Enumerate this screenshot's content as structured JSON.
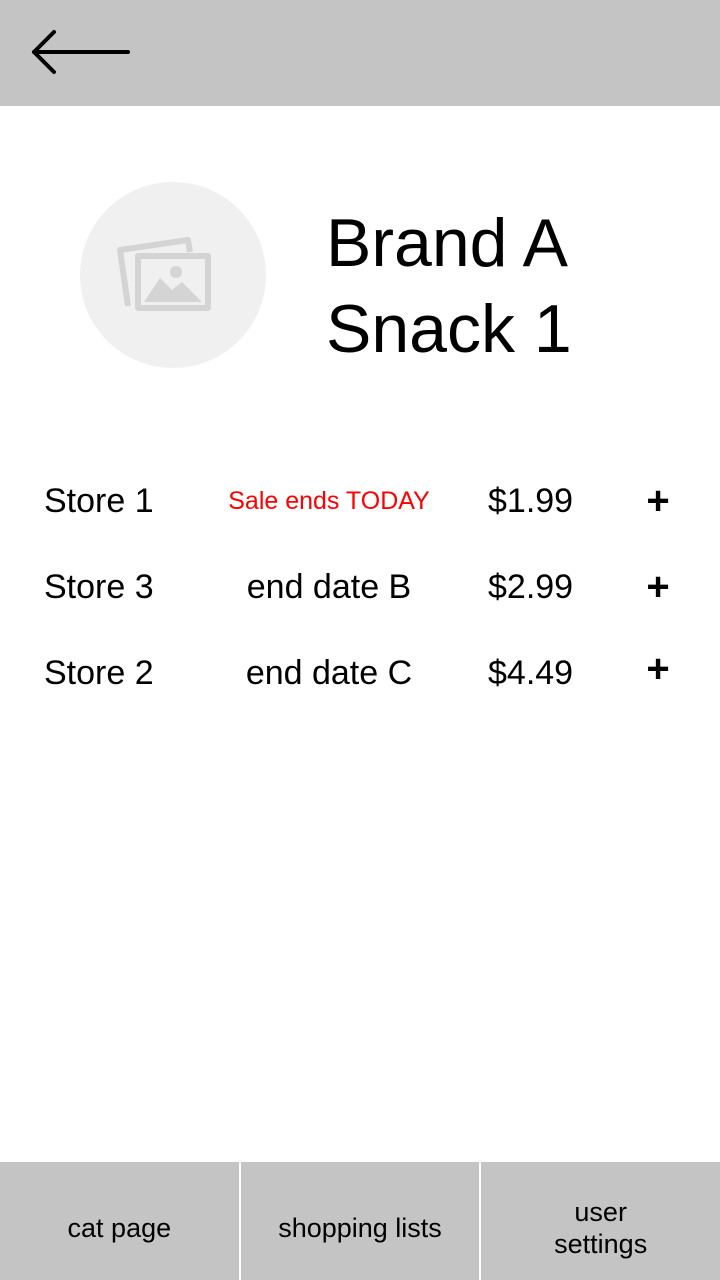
{
  "header": {
    "back_icon": "arrow-left-icon"
  },
  "product": {
    "image_icon": "image-placeholder-icon",
    "title_line1": "Brand A",
    "title_line2": "Snack 1"
  },
  "offers": [
    {
      "store": "Store 1",
      "end_date": "Sale ends TODAY",
      "price": "$1.99",
      "add_label": "+",
      "highlight": true
    },
    {
      "store": "Store 3",
      "end_date": "end date B",
      "price": "$2.99",
      "add_label": "+",
      "highlight": false
    },
    {
      "store": "Store 2",
      "end_date": "end date C",
      "price": "$4.49",
      "add_label": "+",
      "highlight": false
    }
  ],
  "bottom_nav": {
    "items": [
      {
        "label": "cat page"
      },
      {
        "label": "shopping lists"
      },
      {
        "label": "user settings"
      }
    ]
  },
  "colors": {
    "bar_background": "#c4c4c4",
    "sale_text": "#ff0000",
    "image_placeholder_bg": "#f0f0f0"
  }
}
